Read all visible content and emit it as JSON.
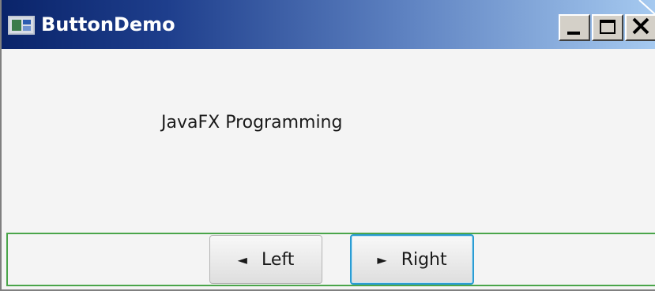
{
  "window": {
    "title": "ButtonDemo",
    "controls": [
      "minimize",
      "maximize",
      "close"
    ]
  },
  "content": {
    "message": "JavaFX Programming"
  },
  "buttons": {
    "left": {
      "label": "Left",
      "icon": "triangle-left-icon"
    },
    "right": {
      "label": "Right",
      "icon": "triangle-right-icon",
      "focused": true
    }
  },
  "colors": {
    "titlebar_start": "#0a246a",
    "titlebar_end": "#a6caf0",
    "pane_border": "#4aa54a",
    "focus_ring": "#2a9cd3"
  }
}
